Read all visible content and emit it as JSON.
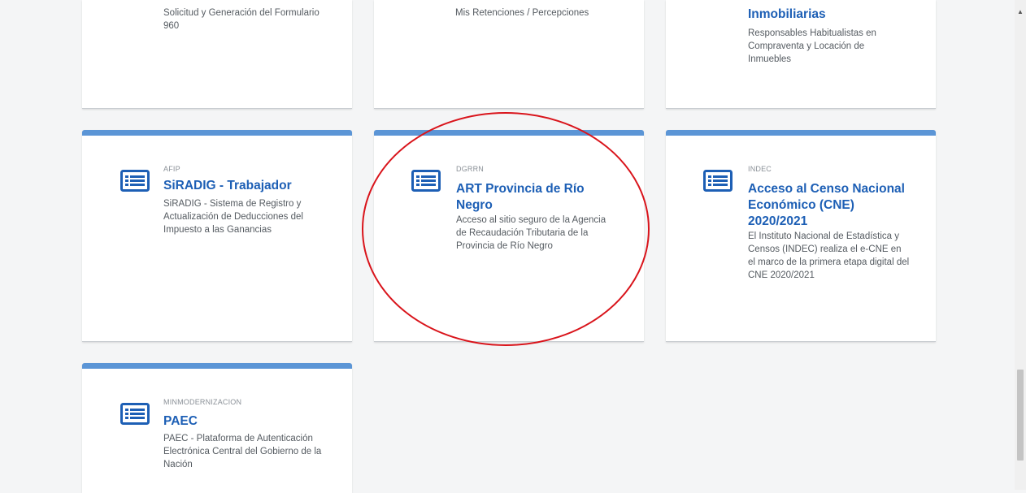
{
  "cards_top": [
    {
      "title": "",
      "desc": "Solicitud y Generación del Formulario 960"
    },
    {
      "title": "",
      "desc": "Mis Retenciones / Percepciones"
    },
    {
      "title": "Inmobiliarias",
      "desc": "Responsables Habitualistas en Compraventa y Locación de Inmuebles"
    }
  ],
  "cards": [
    {
      "org": "AFIP",
      "title": "SiRADIG - Trabajador",
      "desc": "SiRADIG - Sistema de Registro y Actualización de Deducciones del Impuesto a las Ganancias",
      "icon": "list-icon"
    },
    {
      "org": "DGRRN",
      "title": "ART Provincia de Río Negro",
      "desc": "Acceso al sitio seguro de la Agencia de Recaudación Tributaria de la Provincia de Río Negro",
      "icon": "list-icon"
    },
    {
      "org": "INDEC",
      "title": "Acceso al Censo Nacional Económico (CNE) 2020/2021",
      "desc": "El Instituto Nacional de Estadística y Censos (INDEC) realiza el e-CNE en el marco de la primera etapa digital del CNE 2020/2021",
      "icon": "list-icon"
    },
    {
      "org": "MINMODERNIZACION",
      "title": "PAEC",
      "desc": "PAEC - Plataforma de Autenticación Electrónica Central del Gobierno de la Nación",
      "icon": "list-icon"
    }
  ],
  "scrollbar": {
    "up_icon": "▲"
  },
  "colors": {
    "accent": "#5b95d6",
    "title": "#1d5fb5",
    "annotation": "#d9141b",
    "icon": "#1d5fb5"
  }
}
